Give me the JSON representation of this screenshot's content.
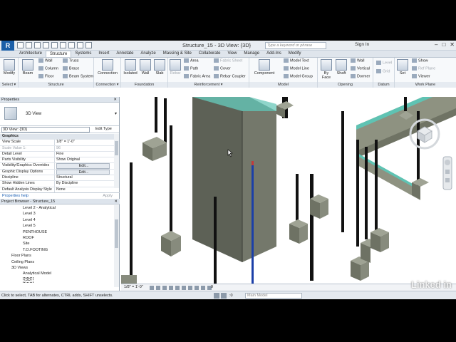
{
  "window": {
    "doc_title": "Structure_15 - 3D View: {3D}",
    "search_placeholder": "Type a keyword or phrase",
    "sign_in": "Sign In"
  },
  "tabs": [
    "Architecture",
    "Structure",
    "Systems",
    "Insert",
    "Annotate",
    "Analyze",
    "Massing & Site",
    "Collaborate",
    "View",
    "Manage",
    "Add-Ins",
    "Modify"
  ],
  "active_tab": "Structure",
  "ribbon": {
    "select": {
      "modify": "Modify",
      "label": "Select ▾"
    },
    "structure": {
      "beam": "Beam",
      "wall": "Wall",
      "column": "Column",
      "floor": "Floor",
      "truss": "Truss",
      "brace": "Brace",
      "beam_system": "Beam System",
      "label": "Structure"
    },
    "connection": {
      "connection": "Connection",
      "label": "Connection ▾"
    },
    "foundation": {
      "isolated": "Isolated",
      "wall": "Wall",
      "slab": "Slab",
      "label": "Foundation"
    },
    "reinforcement": {
      "rebar": "Rebar",
      "area": "Area",
      "path": "Path",
      "fabric_area": "Fabric Area",
      "fabric_sheet": "Fabric Sheet",
      "cover": "Cover",
      "rebar_coupler": "Rebar Coupler",
      "label": "Reinforcement ▾"
    },
    "model": {
      "component": "Component",
      "model_text": "Model Text",
      "model_line": "Model Line",
      "model_group": "Model Group",
      "label": "Model"
    },
    "opening": {
      "by_face": "By Face",
      "shaft": "Shaft",
      "wall": "Wall",
      "vertical": "Vertical",
      "dormer": "Dormer",
      "label": "Opening"
    },
    "datum": {
      "level": "Level",
      "grid": "Grid",
      "label": "Datum"
    },
    "work_plane": {
      "set": "Set",
      "show": "Show",
      "ref_plane": "Ref Plane",
      "viewer": "Viewer",
      "label": "Work Plane"
    }
  },
  "properties": {
    "title": "Properties",
    "type_name": "3D View",
    "instance": "3D View: {3D}",
    "edit_type": "Edit Type",
    "section": "Graphics",
    "rows": [
      {
        "k": "View Scale",
        "v": "1/8\" = 1'-0\""
      },
      {
        "k": "Scale Value    1:",
        "v": "96"
      },
      {
        "k": "Detail Level",
        "v": "Fine"
      },
      {
        "k": "Parts Visibility",
        "v": "Show Original"
      },
      {
        "k": "Visibility/Graphics Overrides",
        "v": "Edit..."
      },
      {
        "k": "Graphic Display Options",
        "v": "Edit..."
      },
      {
        "k": "Discipline",
        "v": "Structural"
      },
      {
        "k": "Show Hidden Lines",
        "v": "By Discipline"
      },
      {
        "k": "Default Analysis Display Style",
        "v": "None"
      }
    ],
    "help": "Properties help",
    "apply": "Apply"
  },
  "project_browser": {
    "title": "Project Browser - Structure_15",
    "items": [
      {
        "label": "Level 2 - Analytical",
        "indent": 3
      },
      {
        "label": "Level 3",
        "indent": 3
      },
      {
        "label": "Level 4",
        "indent": 3
      },
      {
        "label": "Level 5",
        "indent": 3
      },
      {
        "label": "PENTHOUSE",
        "indent": 3
      },
      {
        "label": "ROOF",
        "indent": 3
      },
      {
        "label": "Site",
        "indent": 3
      },
      {
        "label": "T.O.FOOTING",
        "indent": 3
      },
      {
        "label": "Floor Plans",
        "indent": 1
      },
      {
        "label": "Ceiling Plans",
        "indent": 1
      },
      {
        "label": "3D Views",
        "indent": 1
      },
      {
        "label": "Analytical Model",
        "indent": 3
      },
      {
        "label": "{3D}",
        "indent": 3
      }
    ]
  },
  "viewbar": {
    "scale": "1/8\" = 1'-0\"",
    "count": "9"
  },
  "status": {
    "message": "Click to select, TAB for alternates, CTRL adds, SHIFT unselects.",
    "model": "Main Model",
    "count": ":0"
  },
  "watermark": "Linked in"
}
